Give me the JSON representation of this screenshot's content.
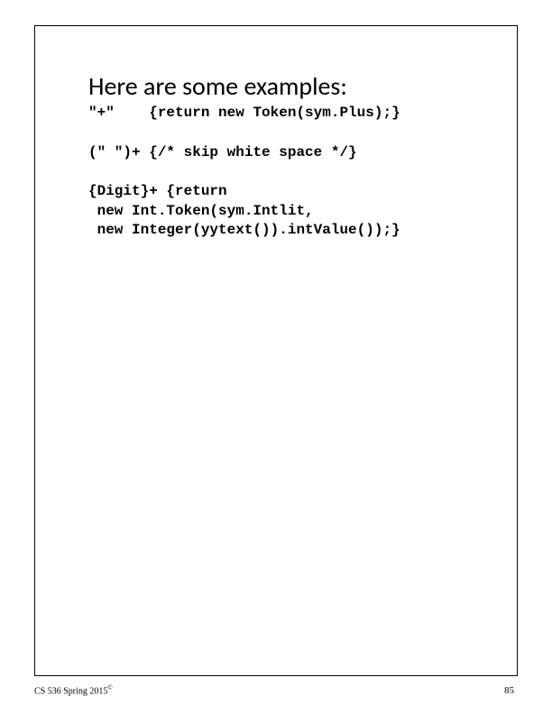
{
  "heading": "Here are some examples:",
  "example1_pattern": "\"+\"",
  "example1_action": "{return new Token(sym.Plus);}",
  "example2_pattern": "(\" \")+",
  "example2_action": "{/* skip white space */}",
  "example3_line1": "{Digit}+ {return",
  "example3_line2": " new Int.Token(sym.Intlit,",
  "example3_line3": " new Integer(yytext()).intValue());}",
  "footer_course": "CS 536  Spring 2015",
  "footer_copyright": "©",
  "page_number": "85"
}
